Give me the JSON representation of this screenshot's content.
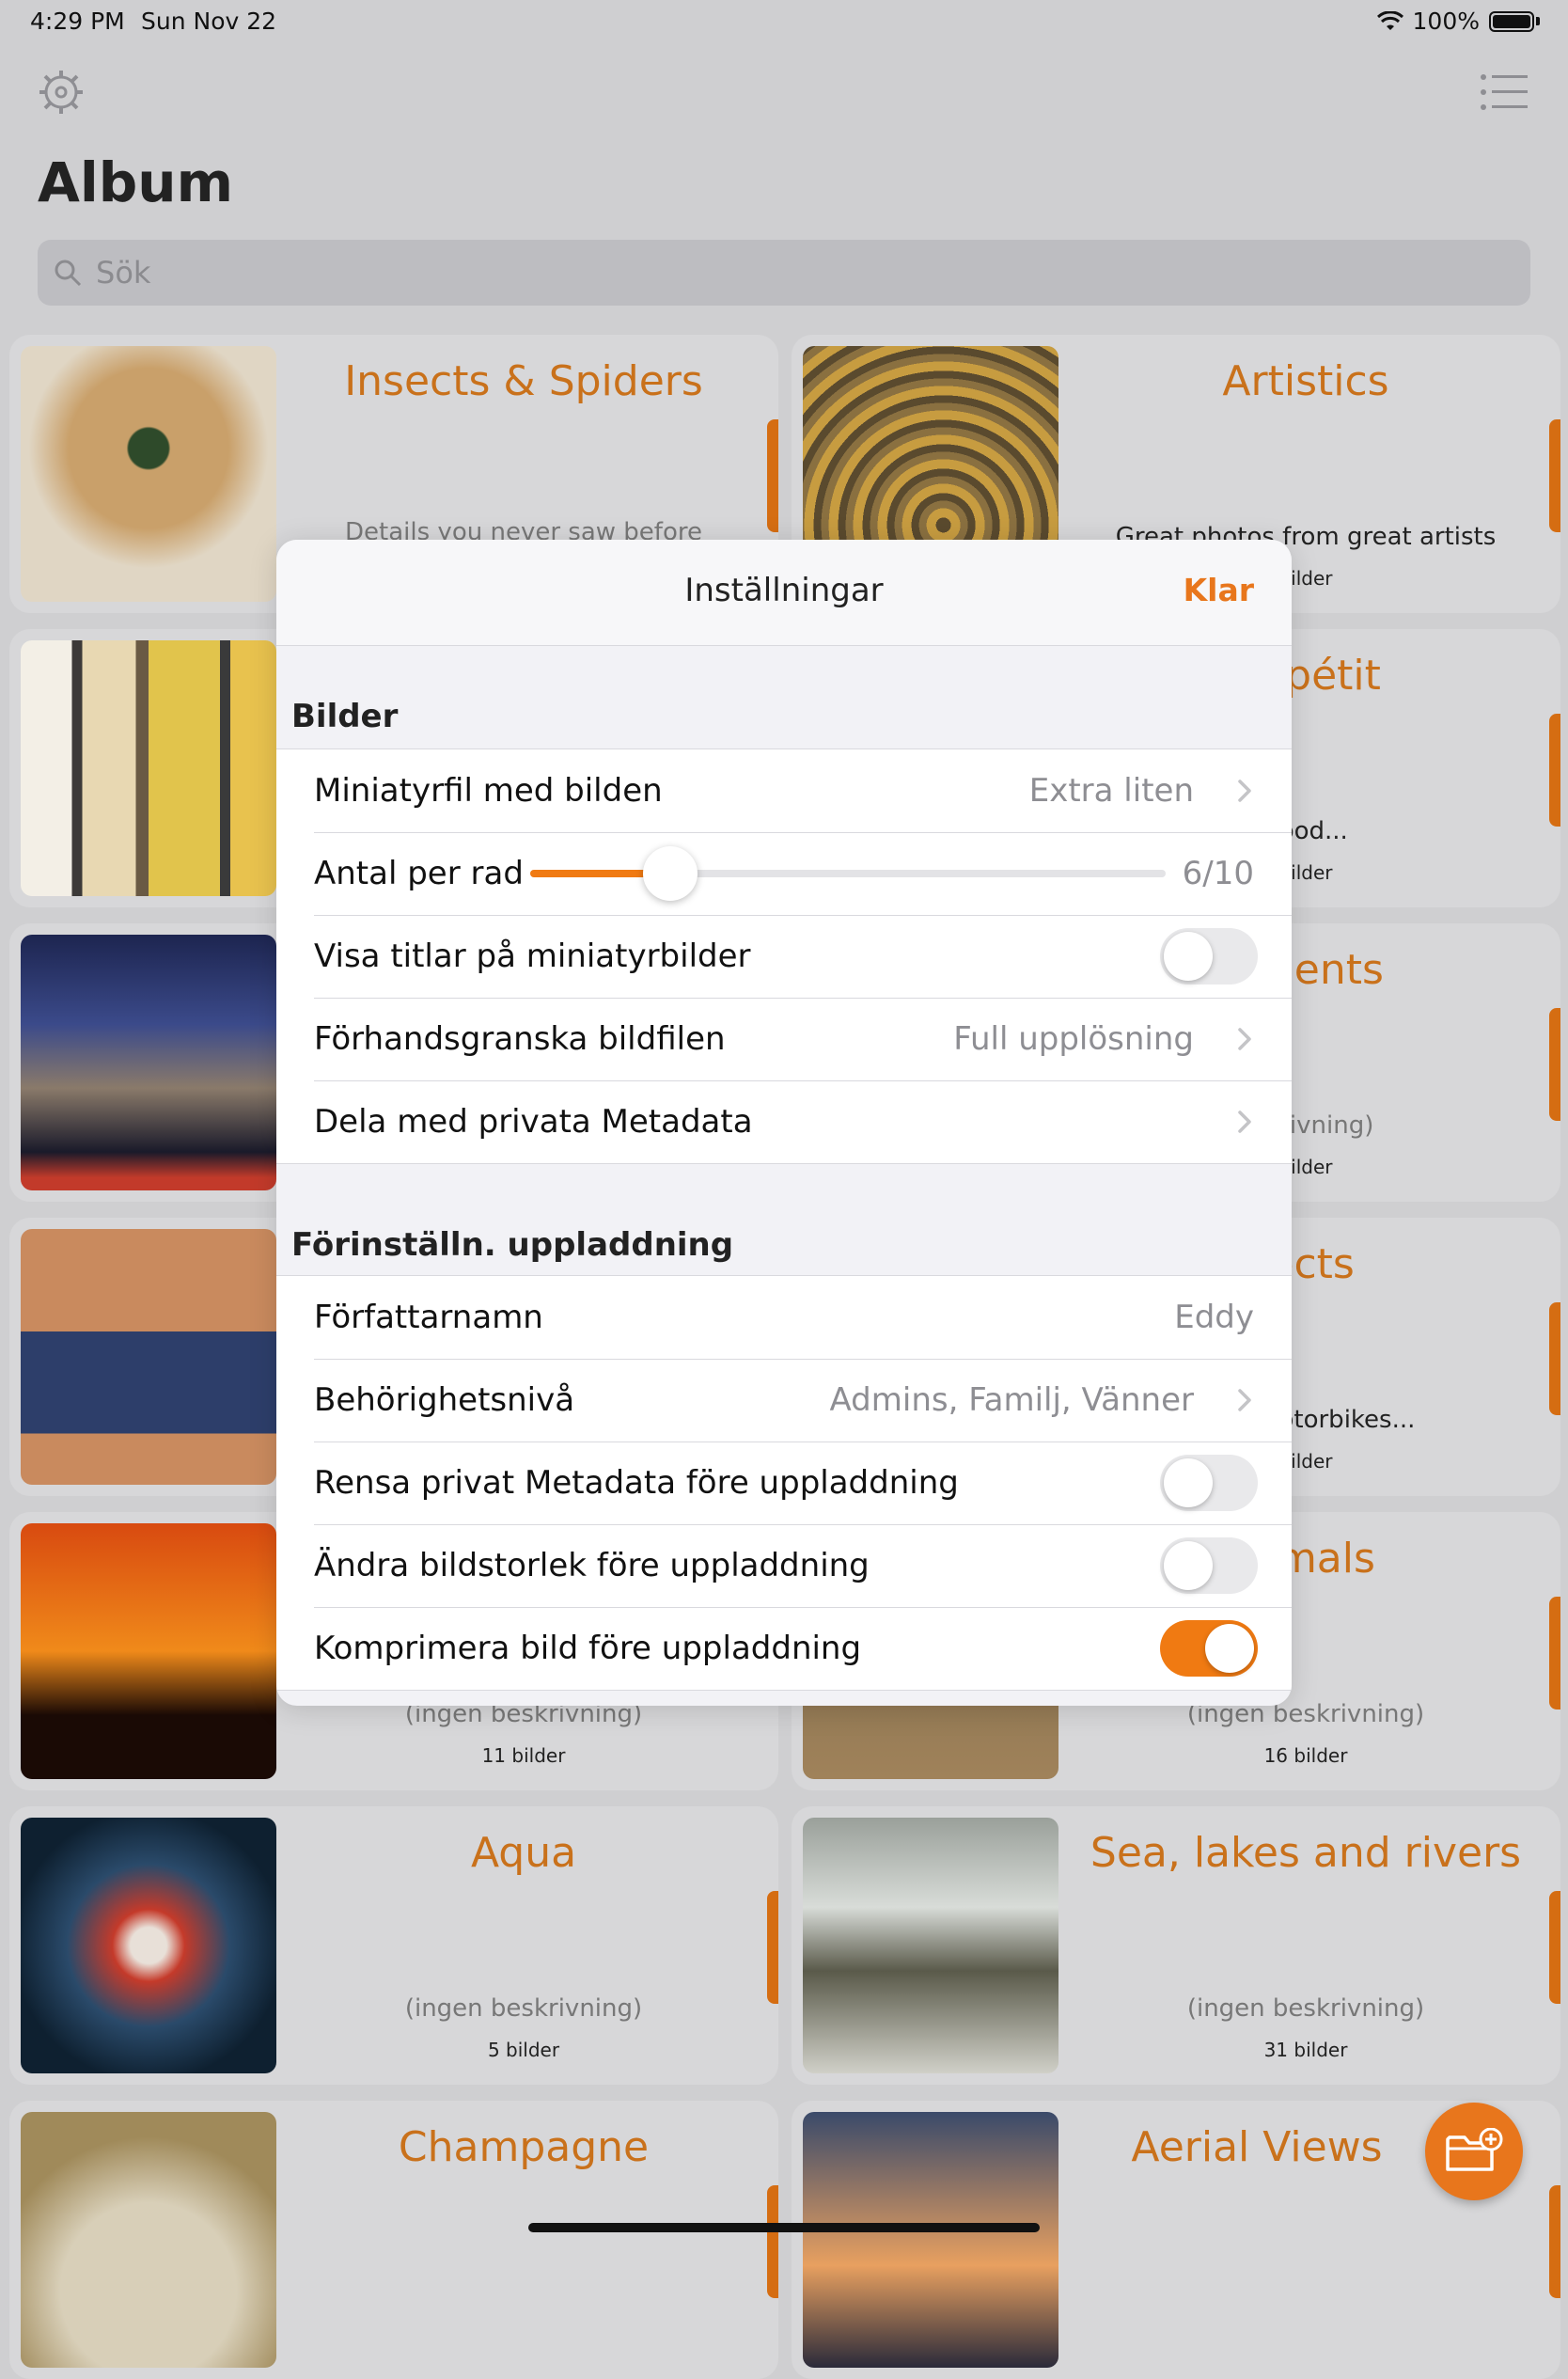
{
  "status": {
    "time": "4:29 PM",
    "date": "Sun Nov 22",
    "battery": "100%"
  },
  "header": {
    "title": "Album",
    "search_placeholder": "Sök"
  },
  "albums": [
    {
      "title": "Insects & Spiders",
      "desc": "Details you never saw before",
      "count": "",
      "thumb": "spider"
    },
    {
      "title": "Artistics",
      "desc": "Great photos from great artists",
      "count": "bilder",
      "thumb": "stairs"
    },
    {
      "title": "Appétit",
      "desc": "good...",
      "count": "bilder",
      "thumb": "houses"
    },
    {
      "title": "uments",
      "desc": "eskrivning)",
      "count": "bilder",
      "thumb": "building"
    },
    {
      "title": "jects",
      "desc": "nes, motorbikes...",
      "count": "bilder",
      "thumb": "person"
    },
    {
      "title": "mmals",
      "desc": "(ingen beskrivning)",
      "count": "16 bilder",
      "thumb": "animals"
    },
    {
      "title": "",
      "desc": "(ingen beskrivning)",
      "count": "11 bilder",
      "thumb": "sunset"
    },
    {
      "title": "Aqua",
      "desc": "(ingen beskrivning)",
      "count": "5 bilder",
      "thumb": "aqua"
    },
    {
      "title": "Sea, lakes and rivers",
      "desc": "(ingen beskrivning)",
      "count": "31 bilder",
      "thumb": "waterfall"
    },
    {
      "title": "Champagne",
      "desc": "",
      "count": "",
      "thumb": "champagne"
    },
    {
      "title": "Aerial Views",
      "desc": "",
      "count": "",
      "thumb": "aerial"
    }
  ],
  "modal": {
    "title": "Inställningar",
    "done": "Klar",
    "sections": {
      "images": {
        "header": "Bilder",
        "thumbnail_label": "Miniatyrfil med bilden",
        "thumbnail_value": "Extra liten",
        "per_row_label": "Antal per rad",
        "per_row_value": "6/10",
        "per_row_fraction": 0.22,
        "show_titles_label": "Visa titlar på miniatyrbilder",
        "show_titles_on": false,
        "preview_label": "Förhandsgranska bildfilen",
        "preview_value": "Full upplösning",
        "share_label": "Dela med privata Metadata"
      },
      "upload": {
        "header": "Förinställn. uppladdning",
        "author_label": "Författarnamn",
        "author_value": "Eddy",
        "privacy_label": "Behörighetsnivå",
        "privacy_value": "Admins, Familj, Vänner",
        "strip_label": "Rensa privat Metadata före uppladdning",
        "strip_on": false,
        "resize_label": "Ändra bildstorlek före uppladdning",
        "resize_on": false,
        "compress_label": "Komprimera bild före uppladdning",
        "compress_on": true
      }
    }
  },
  "colors": {
    "accent": "#e8761c",
    "title_orange": "#c9711b"
  }
}
